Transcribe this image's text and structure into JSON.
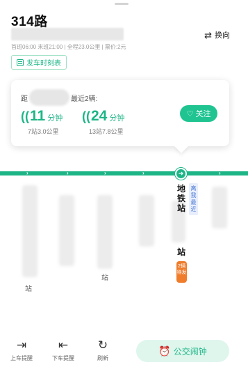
{
  "header": {
    "title": "314路",
    "info": "首班06:00 末班21:00 | 全程23.0公里 | 票价:2元",
    "reverse_label": "换向",
    "timetable_label": "发车时刻表"
  },
  "arrival_card": {
    "distance_prefix": "距",
    "distance_suffix": "最近2辆:",
    "follow_label": "关注",
    "buses": [
      {
        "minutes": "11",
        "unit": "分钟",
        "detail": "7站3.0公里"
      },
      {
        "minutes": "24",
        "unit": "分钟",
        "detail": "13站7.8公里"
      }
    ]
  },
  "stops": {
    "current_name": "地铁站",
    "current_suffix": "站",
    "near_tag": "离我最近",
    "bus_tag": "2辆待发",
    "other_labels": [
      "站",
      "站"
    ]
  },
  "bottom_bar": {
    "board_label": "上车提醒",
    "alight_label": "下车提醒",
    "refresh_label": "刷新",
    "alarm_label": "公交闹钟"
  },
  "colors": {
    "accent": "#1db586",
    "bus_tag": "#ef7d2c",
    "near_tag": "#4d7bd6"
  }
}
